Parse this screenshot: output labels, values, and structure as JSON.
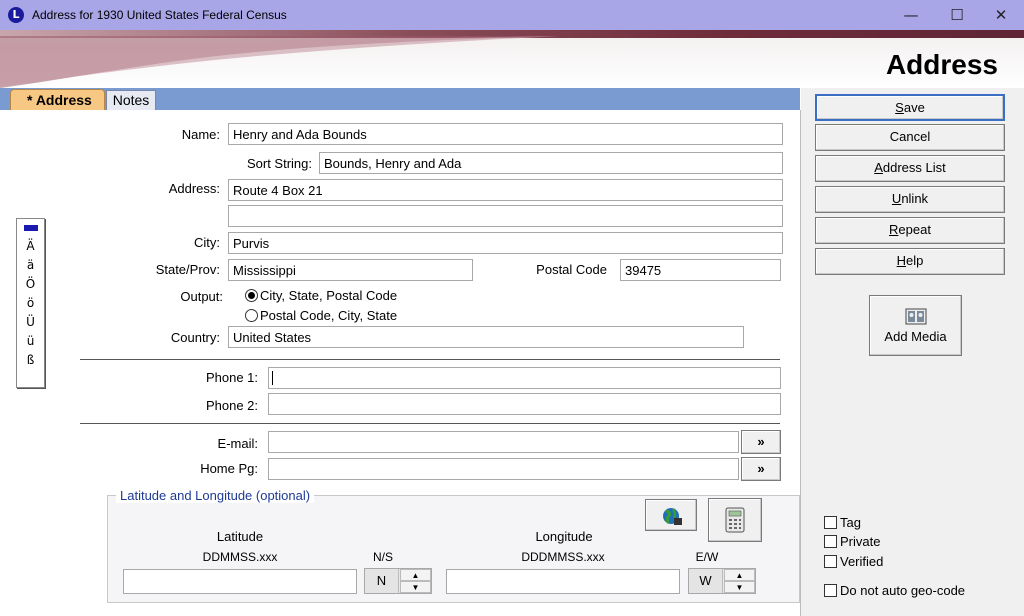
{
  "window": {
    "title": "Address for 1930 United States Federal Census",
    "app_icon_letter": "L"
  },
  "controls": {
    "minimize": "—",
    "maximize": "☐",
    "close": "✕"
  },
  "header": {
    "title": "Address"
  },
  "tabs": [
    {
      "label": "* Address",
      "active": true
    },
    {
      "label": "Notes",
      "active": false
    }
  ],
  "form": {
    "name_label": "Name:",
    "name_value": "Henry and Ada Bounds",
    "sort_label": "Sort String:",
    "sort_value": "Bounds, Henry and Ada",
    "address_label": "Address:",
    "address_line1": "Route 4 Box 21",
    "address_line2": "",
    "city_label": "City:",
    "city_value": "Purvis",
    "state_label": "State/Prov:",
    "state_value": "Mississippi",
    "postal_label": "Postal Code",
    "postal_value": "39475",
    "output_label": "Output:",
    "output_option1": "City, State, Postal Code",
    "output_option2": "Postal Code, City, State",
    "country_label": "Country:",
    "country_value": "United States",
    "phone1_label": "Phone 1:",
    "phone1_value": "",
    "phone2_label": "Phone 2:",
    "phone2_value": "",
    "email_label": "E-mail:",
    "email_value": "",
    "homepage_label": "Home Pg:",
    "homepage_value": "",
    "go_button": "»"
  },
  "latlong": {
    "group_label": "Latitude and Longitude (optional)",
    "lat_label": "Latitude",
    "lat_format": "DDMMSS.xxx",
    "lat_value": "",
    "ns_label": "N/S",
    "ns_value": "N",
    "lon_label": "Longitude",
    "lon_format": "DDDMMSS.xxx",
    "lon_value": "",
    "ew_label": "E/W",
    "ew_value": "W"
  },
  "char_palette": [
    "Ä",
    "ä",
    "Ö",
    "ö",
    "Ü",
    "ü",
    "ß"
  ],
  "sidebar": {
    "buttons": [
      {
        "pre": "",
        "u": "S",
        "post": "ave"
      },
      {
        "pre": "Cancel",
        "u": "",
        "post": ""
      },
      {
        "pre": "",
        "u": "A",
        "post": "ddress List"
      },
      {
        "pre": "",
        "u": "U",
        "post": "nlink"
      },
      {
        "pre": "",
        "u": "R",
        "post": "epeat"
      },
      {
        "pre": "",
        "u": "H",
        "post": "elp"
      }
    ],
    "add_media": "Add Media",
    "checkboxes": [
      {
        "label": "Tag",
        "checked": false
      },
      {
        "label": "Private",
        "checked": false
      },
      {
        "label": "Verified",
        "checked": false
      },
      {
        "label": "Do not auto geo-code",
        "checked": false
      }
    ]
  },
  "colors": {
    "titlebar": "#a9a6e8",
    "tabbar": "#7a9ad2",
    "active_tab": "#f6c884",
    "group_label": "#1f3a93"
  }
}
